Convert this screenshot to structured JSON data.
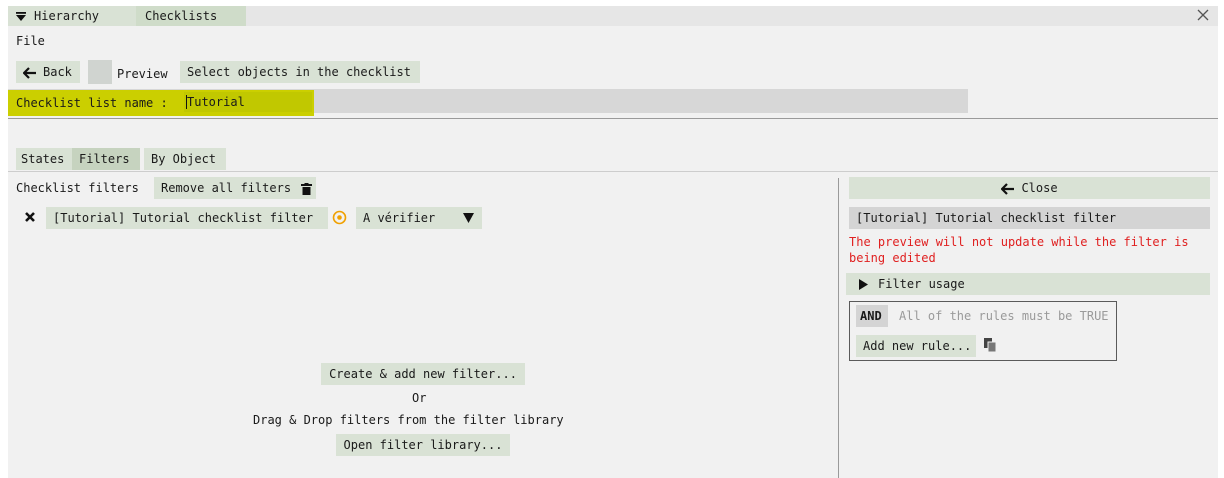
{
  "tabs": [
    {
      "label": "Hierarchy",
      "icon": "triangle-down-icon"
    },
    {
      "label": "Checklists"
    }
  ],
  "window": {
    "close_icon": "close-x-icon"
  },
  "menu": {
    "file": "File"
  },
  "toolbar": {
    "back_label": "Back",
    "back_icon": "arrow-left-icon",
    "preview_label": "Preview",
    "select_objects_label": "Select objects in the checklist"
  },
  "name_field": {
    "label": "Checklist list name :",
    "value": "Tutorial"
  },
  "subtabs": [
    {
      "label": "States"
    },
    {
      "label": "Filters",
      "active": true
    },
    {
      "label": "By Object"
    }
  ],
  "filters_panel": {
    "title": "Checklist filters",
    "remove_all_label": "Remove all filters",
    "remove_all_icon": "trash-icon",
    "filter_item": {
      "remove_icon": "x-icon",
      "name": "[Tutorial] Tutorial  checklist filter",
      "state_icon": "target-circle-icon",
      "state": "A vérifier",
      "dropdown_icon": "triangle-down-icon"
    },
    "create_label": "Create & add new filter...",
    "or_label": "Or",
    "drag_drop_label": "Drag & Drop filters from the filter library",
    "open_library_label": "Open filter library..."
  },
  "editor_panel": {
    "close_label": "Close",
    "close_icon": "arrow-left-icon",
    "filter_name": "[Tutorial] Tutorial  checklist filter",
    "warning_line1": "The preview will not update while the filter is",
    "warning_line2": "being edited",
    "usage_label": "Filter usage",
    "usage_icon": "triangle-right-icon",
    "operator": "AND",
    "operator_placeholder": "All of the rules must be TRUE",
    "add_rule_label": "Add new rule...",
    "paste_icon": "paste-icon"
  },
  "colors": {
    "accent_bg": "#d9e2d5",
    "highlight": "#cbcf00",
    "warning": "#e02020",
    "window_bg": "#f1f1f1"
  }
}
